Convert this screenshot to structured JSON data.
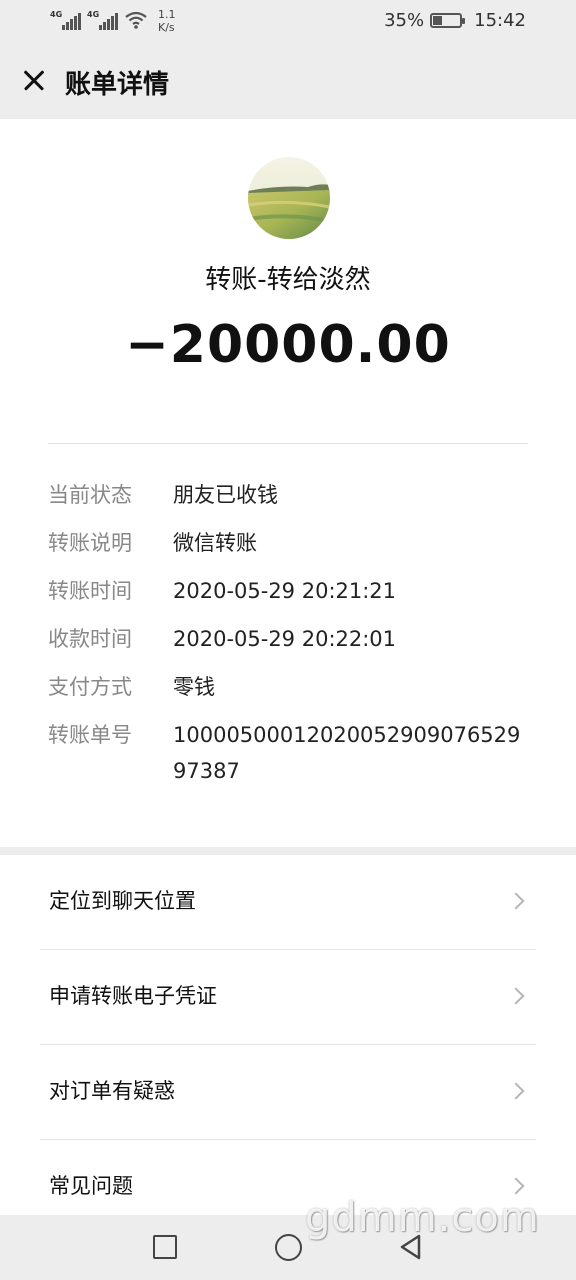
{
  "status_bar": {
    "signal1_label": "4G",
    "signal2_label": "4G",
    "speed_value": "1.1",
    "speed_unit": "K/s",
    "battery": "35%",
    "battery_level": 0.35,
    "time": "15:42"
  },
  "header": {
    "title": "账单详情",
    "close_icon": "close-icon"
  },
  "transfer": {
    "title": "转账-转给淡然",
    "amount": "−20000.00"
  },
  "details": [
    {
      "label": "当前状态",
      "value": "朋友已收钱"
    },
    {
      "label": "转账说明",
      "value": "微信转账"
    },
    {
      "label": "转账时间",
      "value": "2020-05-29 20:21:21"
    },
    {
      "label": "收款时间",
      "value": "2020-05-29 20:22:01"
    },
    {
      "label": "支付方式",
      "value": "零钱"
    },
    {
      "label": "转账单号",
      "value": "1000050001202005290907652997387"
    }
  ],
  "actions": [
    {
      "label": "定位到聊天位置"
    },
    {
      "label": "申请转账电子凭证"
    },
    {
      "label": "对订单有疑惑"
    },
    {
      "label": "常见问题"
    }
  ],
  "watermark": "gdmm.com",
  "nav": {
    "recent_icon": "square-icon",
    "home_icon": "circle-icon",
    "back_icon": "triangle-back-icon"
  }
}
